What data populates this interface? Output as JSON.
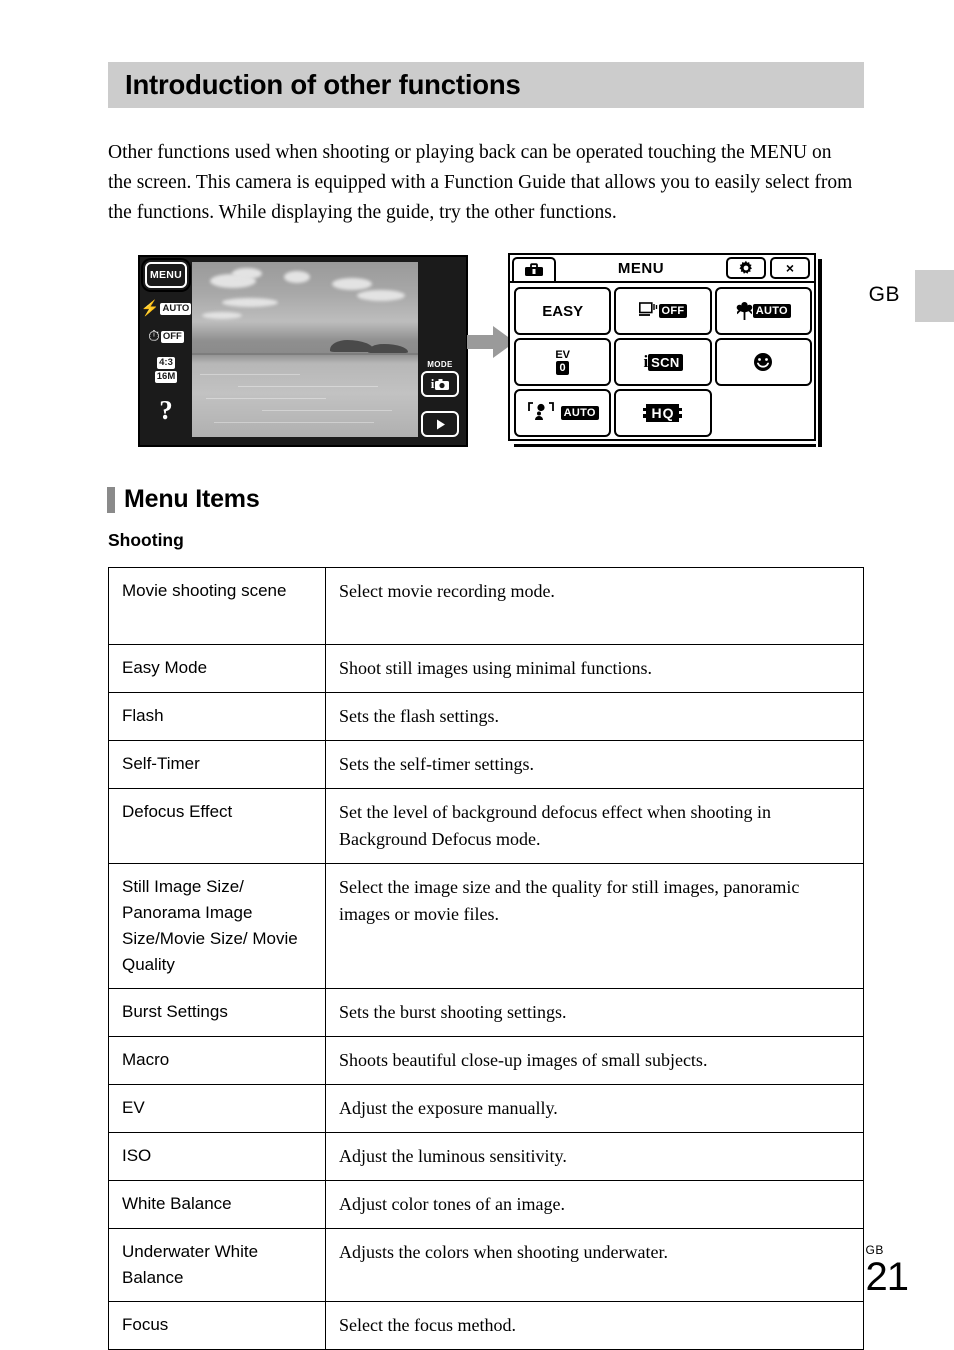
{
  "header": {
    "title": "Introduction of other functions"
  },
  "intro": {
    "paragraph": "Other functions used when shooting or playing back can be operated touching the MENU on the screen. This camera is equipped with a Function Guide that allows you to easily select from the functions. While displaying the guide, try the other functions."
  },
  "figure": {
    "camera_screen": {
      "menu_button_label": "MENU",
      "flash_mode": "AUTO",
      "self_timer": "OFF",
      "aspect_ratio": "4:3",
      "image_size": "16M",
      "function_guide": "?",
      "mode_label": "MODE",
      "mode_value": "i",
      "playback_icon": "play-triangle"
    },
    "arrow": "right-arrow",
    "menu_screen": {
      "tab_icon": "toolbox-icon",
      "title": "MENU",
      "settings_icon": "gear-icon",
      "close_icon": "×",
      "cells": [
        {
          "name": "easy-mode",
          "label": "EASY",
          "badge": ""
        },
        {
          "name": "burst-settings",
          "label": "",
          "badge": "OFF"
        },
        {
          "name": "macro",
          "label": "",
          "badge": "AUTO"
        },
        {
          "name": "ev",
          "label": "EV",
          "badge": "0"
        },
        {
          "name": "scene-selection",
          "label": "i",
          "badge": "SCN"
        },
        {
          "name": "smile-shutter",
          "label": "",
          "badge": ""
        },
        {
          "name": "focus",
          "label": "",
          "badge": "AUTO"
        },
        {
          "name": "movie-quality",
          "label": "",
          "badge": "HQ"
        },
        {
          "name": "empty",
          "label": "",
          "badge": ""
        }
      ]
    }
  },
  "side_marker": {
    "language_code": "GB"
  },
  "section": {
    "heading": "Menu Items",
    "subheading": "Shooting"
  },
  "table": {
    "rows": [
      {
        "name": "Movie shooting scene",
        "description": "Select movie recording mode."
      },
      {
        "name": "Easy Mode",
        "description": "Shoot still images using minimal functions."
      },
      {
        "name": "Flash",
        "description": "Sets the flash settings."
      },
      {
        "name": "Self-Timer",
        "description": "Sets the self-timer settings."
      },
      {
        "name": "Defocus Effect",
        "description": "Set the level of background defocus effect when shooting in Background Defocus mode."
      },
      {
        "name": "Still Image Size/ Panorama Image Size/Movie Size/ Movie Quality",
        "description": "Select the image size and the quality for still images, panoramic images or movie files."
      },
      {
        "name": "Burst Settings",
        "description": "Sets the burst shooting settings."
      },
      {
        "name": "Macro",
        "description": "Shoots beautiful close-up images of small subjects."
      },
      {
        "name": "EV",
        "description": "Adjust the exposure manually."
      },
      {
        "name": "ISO",
        "description": "Adjust the luminous sensitivity."
      },
      {
        "name": "White Balance",
        "description": "Adjust color tones of an image."
      },
      {
        "name": "Underwater White Balance",
        "description": "Adjusts the colors when shooting underwater."
      },
      {
        "name": "Focus",
        "description": "Select the focus method."
      }
    ]
  },
  "footer": {
    "language_code": "GB",
    "page_number": "21"
  }
}
